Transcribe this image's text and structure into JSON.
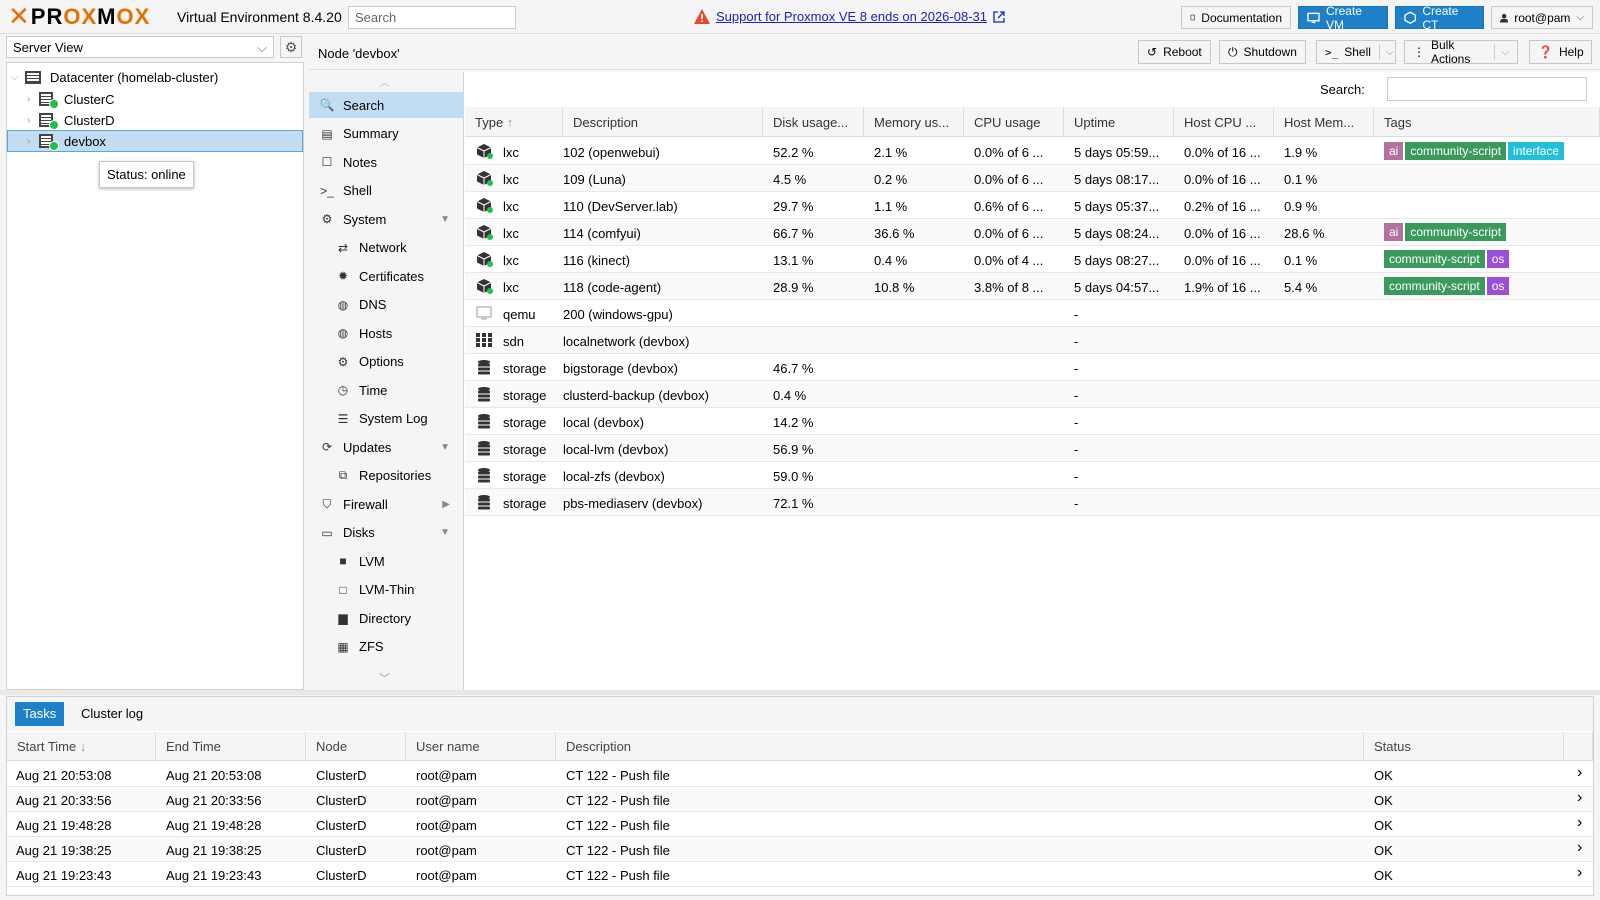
{
  "topbar": {
    "brand": "PROXMOX",
    "product": "Virtual Environment 8.4.20",
    "search_placeholder": "Search",
    "support_link": "Support for Proxmox VE 8 ends on 2026-08-31",
    "documentation": "Documentation",
    "create_vm": "Create VM",
    "create_ct": "Create CT",
    "user": "root@pam"
  },
  "left": {
    "view": "Server View",
    "tree": [
      {
        "label": "Datacenter (homelab-cluster)"
      },
      {
        "label": "ClusterC"
      },
      {
        "label": "ClusterD"
      },
      {
        "label": "devbox"
      }
    ],
    "tooltip": "Status: online"
  },
  "header": {
    "title": "Node 'devbox'",
    "reboot": "Reboot",
    "shutdown": "Shutdown",
    "shell": "Shell",
    "bulk": "Bulk Actions",
    "help": "Help"
  },
  "menu": [
    {
      "label": "Search",
      "icon": "search-icon"
    },
    {
      "label": "Summary",
      "icon": "book-icon"
    },
    {
      "label": "Notes",
      "icon": "notes-icon"
    },
    {
      "label": "Shell",
      "icon": "terminal-icon"
    },
    {
      "label": "System",
      "icon": "cogs-icon"
    },
    {
      "label": "Network",
      "icon": "network-icon"
    },
    {
      "label": "Certificates",
      "icon": "certificate-icon"
    },
    {
      "label": "DNS",
      "icon": "globe-icon"
    },
    {
      "label": "Hosts",
      "icon": "globe-icon"
    },
    {
      "label": "Options",
      "icon": "gear-icon"
    },
    {
      "label": "Time",
      "icon": "clock-icon"
    },
    {
      "label": "System Log",
      "icon": "list-icon"
    },
    {
      "label": "Updates",
      "icon": "refresh-icon"
    },
    {
      "label": "Repositories",
      "icon": "repo-icon"
    },
    {
      "label": "Firewall",
      "icon": "shield-icon"
    },
    {
      "label": "Disks",
      "icon": "hdd-icon"
    },
    {
      "label": "LVM",
      "icon": "square-icon"
    },
    {
      "label": "LVM-Thin",
      "icon": "square-outline-icon"
    },
    {
      "label": "Directory",
      "icon": "folder-icon"
    },
    {
      "label": "ZFS",
      "icon": "grid-icon"
    }
  ],
  "grid": {
    "search_label": "Search:",
    "columns": [
      "Type",
      "Description",
      "Disk usage...",
      "Memory us...",
      "CPU usage",
      "Uptime",
      "Host CPU ...",
      "Host Mem...",
      "Tags"
    ],
    "rows": [
      {
        "type": "lxc",
        "desc": "102 (openwebui)",
        "disk": "52.2 %",
        "mem": "2.1 %",
        "cpu": "0.0% of 6 ...",
        "uptime": "5 days 05:59...",
        "hcpu": "0.0% of 16 ...",
        "hmem": "1.9 %",
        "tags": [
          "ai",
          "community-script",
          "interface"
        ]
      },
      {
        "type": "lxc",
        "desc": "109 (Luna)",
        "disk": "4.5 %",
        "mem": "0.2 %",
        "cpu": "0.0% of 6 ...",
        "uptime": "5 days 08:17...",
        "hcpu": "0.0% of 16 ...",
        "hmem": "0.1 %",
        "tags": []
      },
      {
        "type": "lxc",
        "desc": "110 (DevServer.lab)",
        "disk": "29.7 %",
        "mem": "1.1 %",
        "cpu": "0.6% of 6 ...",
        "uptime": "5 days 05:37...",
        "hcpu": "0.2% of 16 ...",
        "hmem": "0.9 %",
        "tags": []
      },
      {
        "type": "lxc",
        "desc": "114 (comfyui)",
        "disk": "66.7 %",
        "mem": "36.6 %",
        "cpu": "0.0% of 6 ...",
        "uptime": "5 days 08:24...",
        "hcpu": "0.0% of 16 ...",
        "hmem": "28.6 %",
        "tags": [
          "ai",
          "community-script"
        ]
      },
      {
        "type": "lxc",
        "desc": "116 (kinect)",
        "disk": "13.1 %",
        "mem": "0.4 %",
        "cpu": "0.0% of 4 ...",
        "uptime": "5 days 08:27...",
        "hcpu": "0.0% of 16 ...",
        "hmem": "0.1 %",
        "tags": [
          "community-script",
          "os"
        ]
      },
      {
        "type": "lxc",
        "desc": "118 (code-agent)",
        "disk": "28.9 %",
        "mem": "10.8 %",
        "cpu": "3.8% of 8 ...",
        "uptime": "5 days 04:57...",
        "hcpu": "1.9% of 16 ...",
        "hmem": "5.4 %",
        "tags": [
          "community-script",
          "os"
        ]
      },
      {
        "type": "qemu",
        "desc": "200 (windows-gpu)",
        "disk": "",
        "mem": "",
        "cpu": "",
        "uptime": "-",
        "hcpu": "",
        "hmem": "",
        "tags": []
      },
      {
        "type": "sdn",
        "desc": "localnetwork (devbox)",
        "disk": "",
        "mem": "",
        "cpu": "",
        "uptime": "-",
        "hcpu": "",
        "hmem": "",
        "tags": []
      },
      {
        "type": "storage",
        "desc": "bigstorage (devbox)",
        "disk": "46.7 %",
        "mem": "",
        "cpu": "",
        "uptime": "-",
        "hcpu": "",
        "hmem": "",
        "tags": []
      },
      {
        "type": "storage",
        "desc": "clusterd-backup (devbox)",
        "disk": "0.4 %",
        "mem": "",
        "cpu": "",
        "uptime": "-",
        "hcpu": "",
        "hmem": "",
        "tags": []
      },
      {
        "type": "storage",
        "desc": "local (devbox)",
        "disk": "14.2 %",
        "mem": "",
        "cpu": "",
        "uptime": "-",
        "hcpu": "",
        "hmem": "",
        "tags": []
      },
      {
        "type": "storage",
        "desc": "local-lvm (devbox)",
        "disk": "56.9 %",
        "mem": "",
        "cpu": "",
        "uptime": "-",
        "hcpu": "",
        "hmem": "",
        "tags": []
      },
      {
        "type": "storage",
        "desc": "local-zfs (devbox)",
        "disk": "59.0 %",
        "mem": "",
        "cpu": "",
        "uptime": "-",
        "hcpu": "",
        "hmem": "",
        "tags": []
      },
      {
        "type": "storage",
        "desc": "pbs-mediaserv (devbox)",
        "disk": "72.1 %",
        "mem": "",
        "cpu": "",
        "uptime": "-",
        "hcpu": "",
        "hmem": "",
        "tags": []
      }
    ],
    "tag_colors": {
      "ai": "#b0739f",
      "community-script": "#3a9a5c",
      "interface": "#22c0d6",
      "os": "#9b4fd8"
    }
  },
  "bottom": {
    "tabs": [
      "Tasks",
      "Cluster log"
    ],
    "columns": [
      "Start Time",
      "End Time",
      "Node",
      "User name",
      "Description",
      "Status"
    ],
    "rows": [
      {
        "start": "Aug 21 20:53:08",
        "end": "Aug 21 20:53:08",
        "node": "ClusterD",
        "user": "root@pam",
        "desc": "CT 122 - Push file",
        "status": "OK"
      },
      {
        "start": "Aug 21 20:33:56",
        "end": "Aug 21 20:33:56",
        "node": "ClusterD",
        "user": "root@pam",
        "desc": "CT 122 - Push file",
        "status": "OK"
      },
      {
        "start": "Aug 21 19:48:28",
        "end": "Aug 21 19:48:28",
        "node": "ClusterD",
        "user": "root@pam",
        "desc": "CT 122 - Push file",
        "status": "OK"
      },
      {
        "start": "Aug 21 19:38:25",
        "end": "Aug 21 19:38:25",
        "node": "ClusterD",
        "user": "root@pam",
        "desc": "CT 122 - Push file",
        "status": "OK"
      },
      {
        "start": "Aug 21 19:23:43",
        "end": "Aug 21 19:23:43",
        "node": "ClusterD",
        "user": "root@pam",
        "desc": "CT 122 - Push file",
        "status": "OK"
      }
    ]
  }
}
